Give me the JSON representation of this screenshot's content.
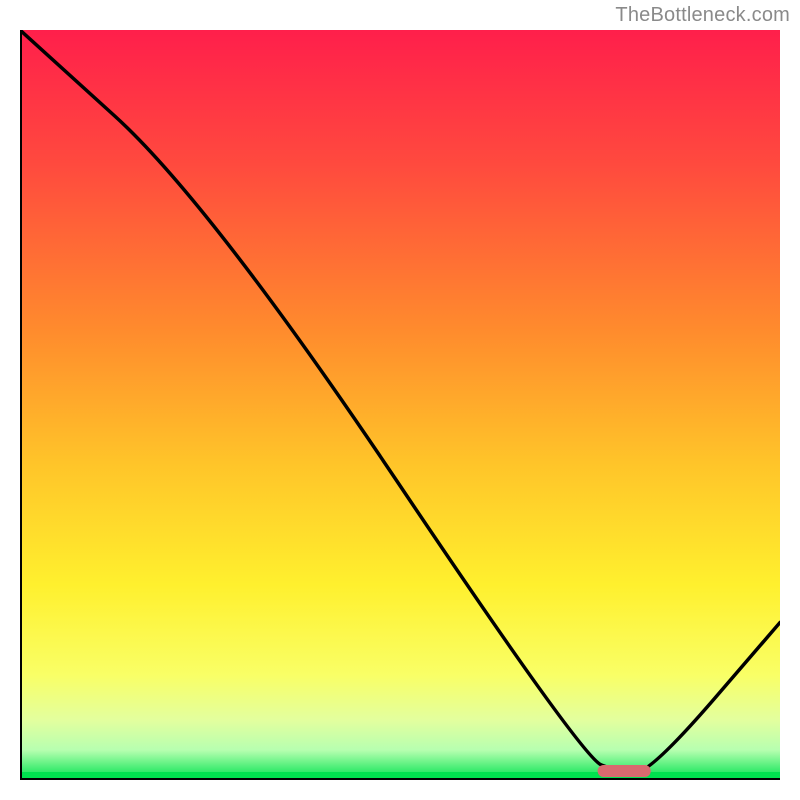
{
  "attribution": "TheBottleneck.com",
  "chart_data": {
    "type": "line",
    "title": "",
    "xlabel": "",
    "ylabel": "",
    "xlim": [
      0,
      100
    ],
    "ylim": [
      0,
      100
    ],
    "series": [
      {
        "name": "curve",
        "x": [
          0,
          25,
          74,
          79,
          83,
          100
        ],
        "values": [
          100,
          77,
          3,
          1,
          1,
          21
        ]
      }
    ],
    "marker": {
      "x_start": 76,
      "x_end": 83,
      "y": 1.2,
      "color": "#d96a6f"
    },
    "gradient_stops": [
      {
        "offset": 0.0,
        "color": "#ff1f4b"
      },
      {
        "offset": 0.18,
        "color": "#ff4a3e"
      },
      {
        "offset": 0.4,
        "color": "#ff8b2d"
      },
      {
        "offset": 0.58,
        "color": "#ffc529"
      },
      {
        "offset": 0.74,
        "color": "#fff02e"
      },
      {
        "offset": 0.86,
        "color": "#f9ff66"
      },
      {
        "offset": 0.92,
        "color": "#e3ff9e"
      },
      {
        "offset": 0.96,
        "color": "#b7ffb0"
      },
      {
        "offset": 1.0,
        "color": "#00e24f"
      }
    ],
    "axis_color": "#000000",
    "curve_color": "#000000"
  }
}
